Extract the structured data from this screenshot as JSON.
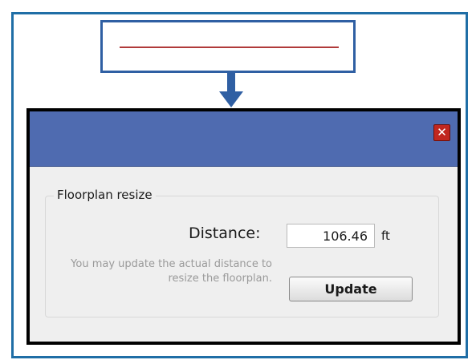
{
  "dialog": {
    "close_glyph": "✕",
    "close_icon": "close-icon",
    "fieldset_legend": "Floorplan resize",
    "distance_label": "Distance:",
    "distance_value": "106.46",
    "distance_unit": "ft",
    "help_text": "You may update the actual distance to resize the floorplan.",
    "update_label": "Update"
  },
  "colors": {
    "frame": "#1f6ea6",
    "callout": "#2f5fa3",
    "measure_line": "#b03a3a",
    "titlebar": "#4f6bb0",
    "close_button": "#c1271f"
  }
}
